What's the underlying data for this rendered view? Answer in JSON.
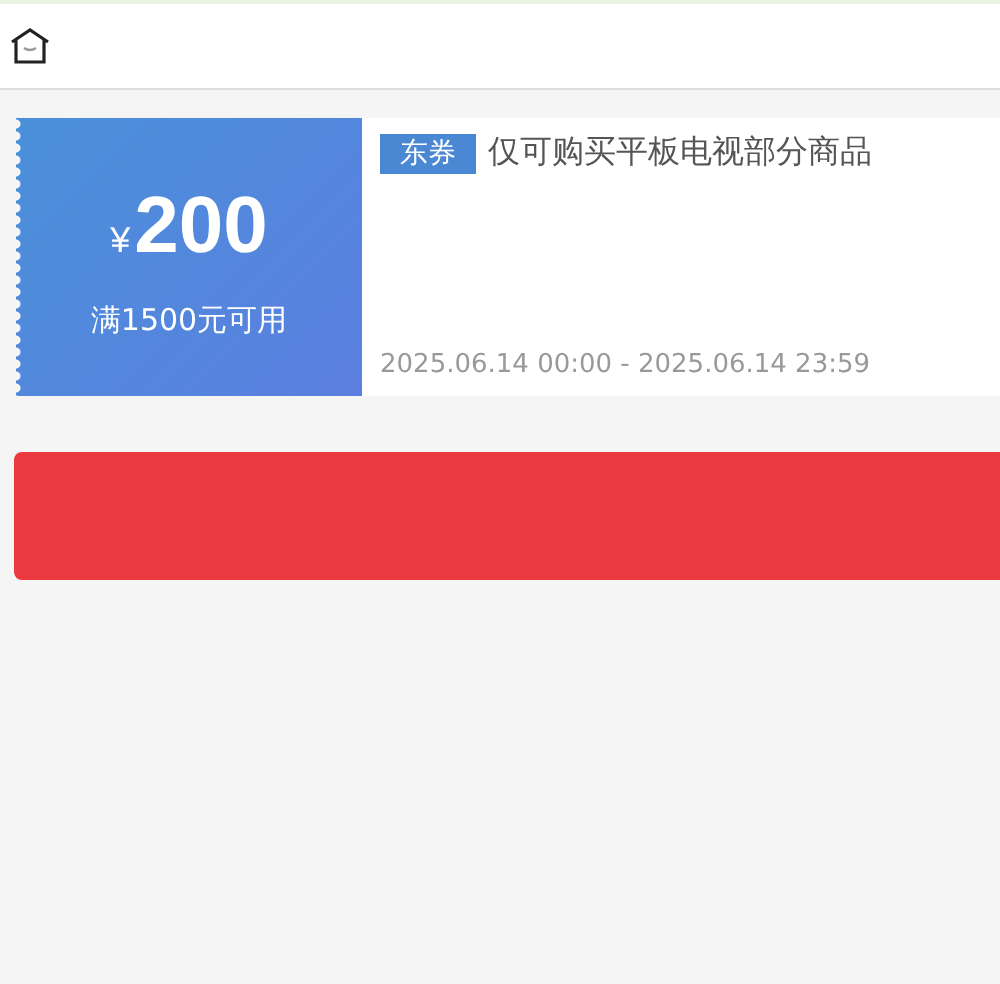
{
  "coupon": {
    "currency": "¥",
    "amount": "200",
    "condition": "满1500元可用",
    "tag": "东券",
    "title": "仅可购买平板电视部分商品",
    "validity": "2025.06.14 00:00 - 2025.06.14 23:59"
  }
}
